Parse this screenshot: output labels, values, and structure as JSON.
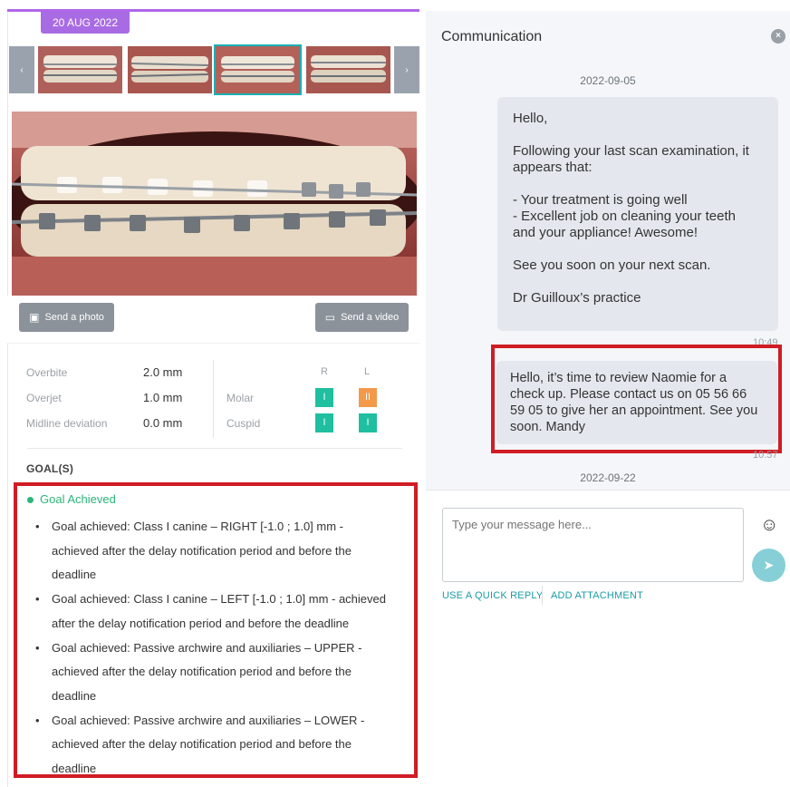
{
  "left": {
    "date_badge": "20 AUG 2022",
    "nav_prev": "‹",
    "nav_next": "›",
    "send_photo_label": "Send a photo",
    "send_video_label": "Send a video",
    "measures": {
      "overbite_label": "Overbite",
      "overbite_value": "2.0 mm",
      "overjet_label": "Overjet",
      "overjet_value": "1.0 mm",
      "midline_label": "Midline deviation",
      "midline_value": "0.0 mm",
      "r_head": "R",
      "l_head": "L",
      "molar_label": "Molar",
      "cuspid_label": "Cuspid",
      "molar_r": "I",
      "molar_l": "II",
      "cuspid_r": "I",
      "cuspid_l": "I",
      "colors": {
        "teal": "#1fbf9f",
        "orange": "#f2994a"
      }
    },
    "goals_title": "GOAL(S)",
    "goal_status": "Goal Achieved",
    "goals": [
      "Goal achieved: Class I canine – RIGHT [-1.0 ; 1.0] mm - achieved after the delay notification period and before the deadline",
      "Goal achieved: Class I canine – LEFT [-1.0 ; 1.0] mm - achieved after the delay notification period and before the deadline",
      "Goal achieved: Passive archwire and auxiliaries – UPPER - achieved after the delay notification period and before the deadline",
      "Goal achieved: Passive archwire and auxiliaries – LOWER - achieved after the delay notification period and before the deadline"
    ]
  },
  "right": {
    "title": "Communication",
    "close_icon": "×",
    "date_1": "2022-09-05",
    "message_1": {
      "greeting": "Hello,",
      "intro": "Following your last scan examination, it appears that:",
      "points": "- Your treatment is going well\n- Excellent job on cleaning your teeth\n   and your appliance! Awesome!",
      "closing": "See you soon on your next scan.",
      "signature": "Dr Guilloux’s practice"
    },
    "time_1": "10:49",
    "message_2": "Hello, it’s time to review Naomie for a check up. Please contact us on 05 56 66 59 05 to give her an appointment. See you soon. Mandy",
    "time_2": "10:57",
    "date_2": "2022-09-22",
    "input_placeholder": "Type your message here...",
    "quick_reply": "USE A QUICK REPLY",
    "attachment": "ADD ATTACHMENT"
  },
  "accent_colors": {
    "purple": "#a96be3",
    "highlight_red": "#d01c24",
    "link_teal": "#1a9ca6"
  }
}
